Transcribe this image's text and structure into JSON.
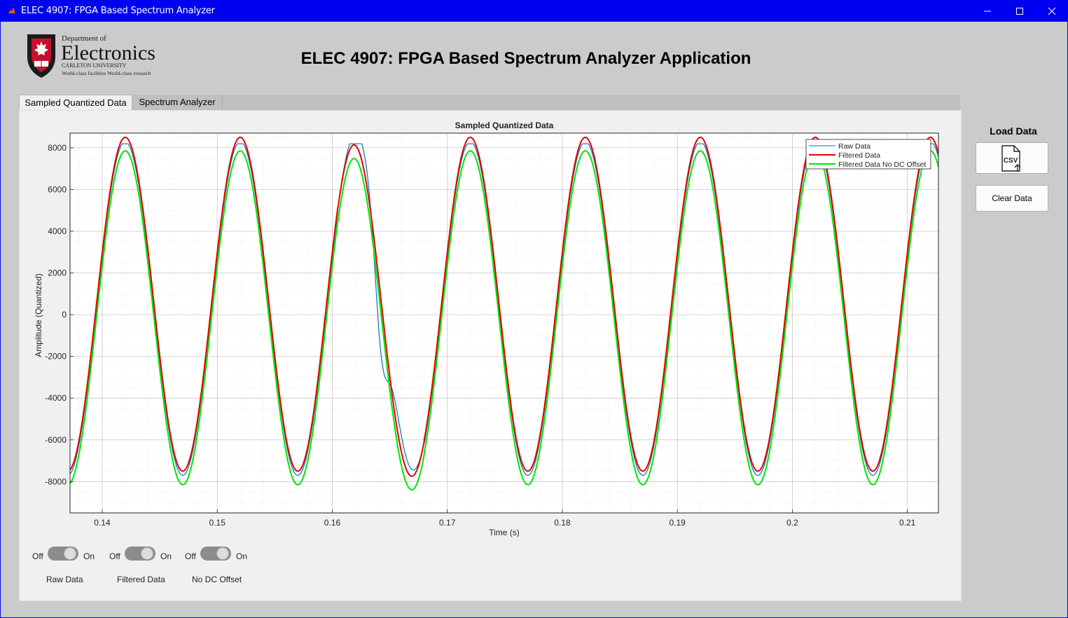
{
  "window": {
    "title": "ELEC 4907: FPGA Based Spectrum Analyzer Application",
    "titlebar_text": "ELEC 4907: FPGA Based Spectrum Analyzer",
    "controls": {
      "minimize": "—",
      "maximize": "☐",
      "close": "✕"
    }
  },
  "logo": {
    "line1": "Department of",
    "line2": "Electronics",
    "line3": "CARLETON UNIVERSITY",
    "line4": "World-class facilities  World-class research"
  },
  "tabs": [
    {
      "label": "Sampled Quantized Data",
      "active": true
    },
    {
      "label": "Spectrum Analyzer",
      "active": false
    }
  ],
  "right_pane": {
    "load_title": "Load Data",
    "load_icon": "csv-file-upload-icon",
    "load_icon_text": "CSV",
    "clear_label": "Clear Data"
  },
  "toggles": [
    {
      "off": "Off",
      "on": "On",
      "label": "Raw Data"
    },
    {
      "off": "Off",
      "on": "On",
      "label": "Filtered Data"
    },
    {
      "off": "Off",
      "on": "On",
      "label": "No DC Offset"
    }
  ],
  "chart_data": {
    "type": "line",
    "title": "Sampled Quantized Data",
    "xlabel": "Time (s)",
    "ylabel": "Amplitude (Quantized)",
    "xlim": [
      0.1372,
      0.2127
    ],
    "ylim": [
      -9500,
      8700
    ],
    "xticks": [
      0.14,
      0.15,
      0.16,
      0.17,
      0.18,
      0.19,
      0.2,
      0.21
    ],
    "xtick_labels": [
      "0.14",
      "0.15",
      "0.16",
      "0.17",
      "0.18",
      "0.19",
      "0.2",
      "0.21"
    ],
    "yticks": [
      -8000,
      -6000,
      -4000,
      -2000,
      0,
      2000,
      4000,
      6000,
      8000
    ],
    "ytick_labels": [
      "-8000",
      "-6000",
      "-4000",
      "-2000",
      "0",
      "2000",
      "4000",
      "6000",
      "8000"
    ],
    "grid": true,
    "minor_grid": true,
    "legend_position": "top-right",
    "signal": {
      "frequency_hz": 100,
      "peak_time_s": 0.142,
      "glitch_window_s": [
        0.1605,
        0.168
      ],
      "saturation_level": 8190,
      "glitch_dip": 4080
    },
    "series": [
      {
        "name": "Raw Data",
        "color": "#0072bd",
        "amplitude": 8000,
        "offset": 300,
        "clip": 8190
      },
      {
        "name": "Filtered Data",
        "color": "#e60000",
        "amplitude": 8000,
        "offset": 500
      },
      {
        "name": "Filtered Data No DC Offset",
        "color": "#00e600",
        "amplitude": 8000,
        "offset": -150
      }
    ]
  }
}
